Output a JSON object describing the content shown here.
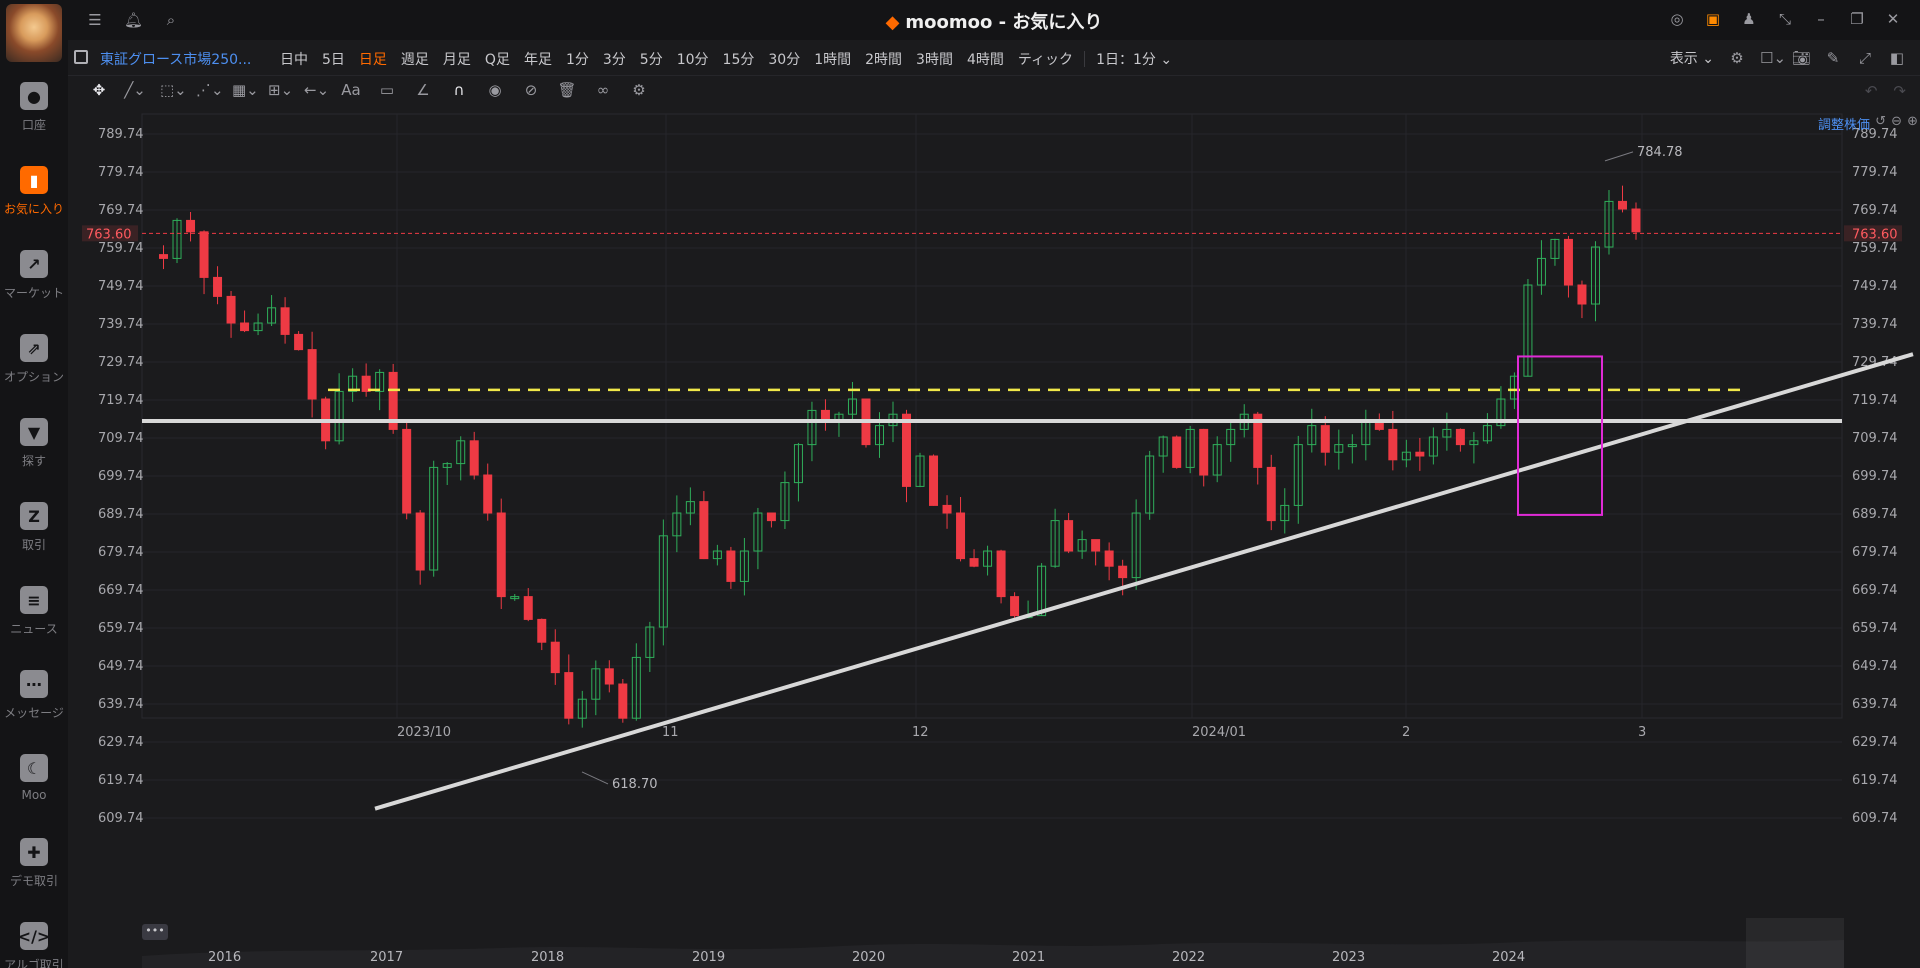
{
  "app": {
    "title": "moomoo - お気に入り"
  },
  "sidebar": {
    "items": [
      {
        "label": "口座",
        "icon": "person-icon"
      },
      {
        "label": "お気に入り",
        "icon": "bar-chart-icon",
        "active": true
      },
      {
        "label": "マーケット",
        "icon": "trend-icon"
      },
      {
        "label": "オプション",
        "icon": "options-icon"
      },
      {
        "label": "探す",
        "icon": "funnel-icon"
      },
      {
        "label": "取引",
        "icon": "trade-icon"
      },
      {
        "label": "ニュース",
        "icon": "news-icon"
      },
      {
        "label": "メッセージ",
        "icon": "chat-icon"
      },
      {
        "label": "Moo",
        "icon": "moon-icon"
      },
      {
        "label": "デモ取引",
        "icon": "gamepad-icon"
      },
      {
        "label": "アルゴ取引",
        "icon": "code-icon"
      }
    ]
  },
  "toolbar": {
    "symbol": "東証グロース市場250...",
    "timeframes": [
      "日中",
      "5日",
      "日足",
      "週足",
      "月足",
      "Q足",
      "年足",
      "1分",
      "3分",
      "5分",
      "10分",
      "15分",
      "30分",
      "1時間",
      "2時間",
      "3時間",
      "4時間",
      "ティック"
    ],
    "active_timeframe": "日足",
    "interval_select": "1日：1分",
    "display_label": "表示"
  },
  "chart": {
    "adjusted_label": "調整株価",
    "current_price": "763.60",
    "high_label": "784.78",
    "low_label": "618.70",
    "y_ticks": [
      "789.74",
      "779.74",
      "769.74",
      "759.74",
      "749.74",
      "739.74",
      "729.74",
      "719.74",
      "709.74",
      "699.74",
      "689.74",
      "679.74",
      "669.74",
      "659.74",
      "649.74",
      "639.74",
      "629.74",
      "619.74",
      "609.74"
    ],
    "x_labels": [
      "2023/10",
      "11",
      "12",
      "2024/01",
      "2",
      "3"
    ]
  },
  "navigator": {
    "years": [
      "2016",
      "2017",
      "2018",
      "2019",
      "2020",
      "2021",
      "2022",
      "2023",
      "2024"
    ],
    "dots_label": "•••"
  },
  "colors": {
    "up": "#2fae5a",
    "down": "#ee3a44",
    "accent": "#ff6a00",
    "link": "#4d8ff0"
  }
}
